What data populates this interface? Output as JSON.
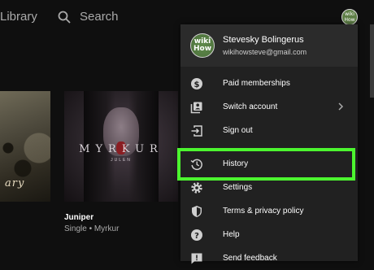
{
  "header": {
    "library_label": "Library",
    "search_label": "Search",
    "avatar_text": "wiki How"
  },
  "content": {
    "left_tile_text": "ary",
    "album": {
      "cover_title": "MYRKUR",
      "cover_subtitle": "JULEN",
      "title": "Juniper",
      "subtitle": "Single • Myrkur"
    }
  },
  "account_menu": {
    "user_name": "Stevesky Bolingerus",
    "user_email": "wikihowsteve@gmail.com",
    "avatar_text": "wiki How",
    "items": [
      {
        "label": "Paid memberships",
        "icon": "dollar-icon"
      },
      {
        "label": "Switch account",
        "icon": "switch-account-icon",
        "has_chevron": true
      },
      {
        "label": "Sign out",
        "icon": "sign-out-icon"
      },
      {
        "label": "History",
        "icon": "history-icon",
        "highlighted": true
      },
      {
        "label": "Settings",
        "icon": "gear-icon"
      },
      {
        "label": "Terms & privacy policy",
        "icon": "shield-icon"
      },
      {
        "label": "Help",
        "icon": "help-icon"
      },
      {
        "label": "Send feedback",
        "icon": "feedback-icon"
      }
    ]
  },
  "colors": {
    "background": "#0f0f0f",
    "menu_background": "#212121",
    "highlight": "#4cf52f"
  }
}
